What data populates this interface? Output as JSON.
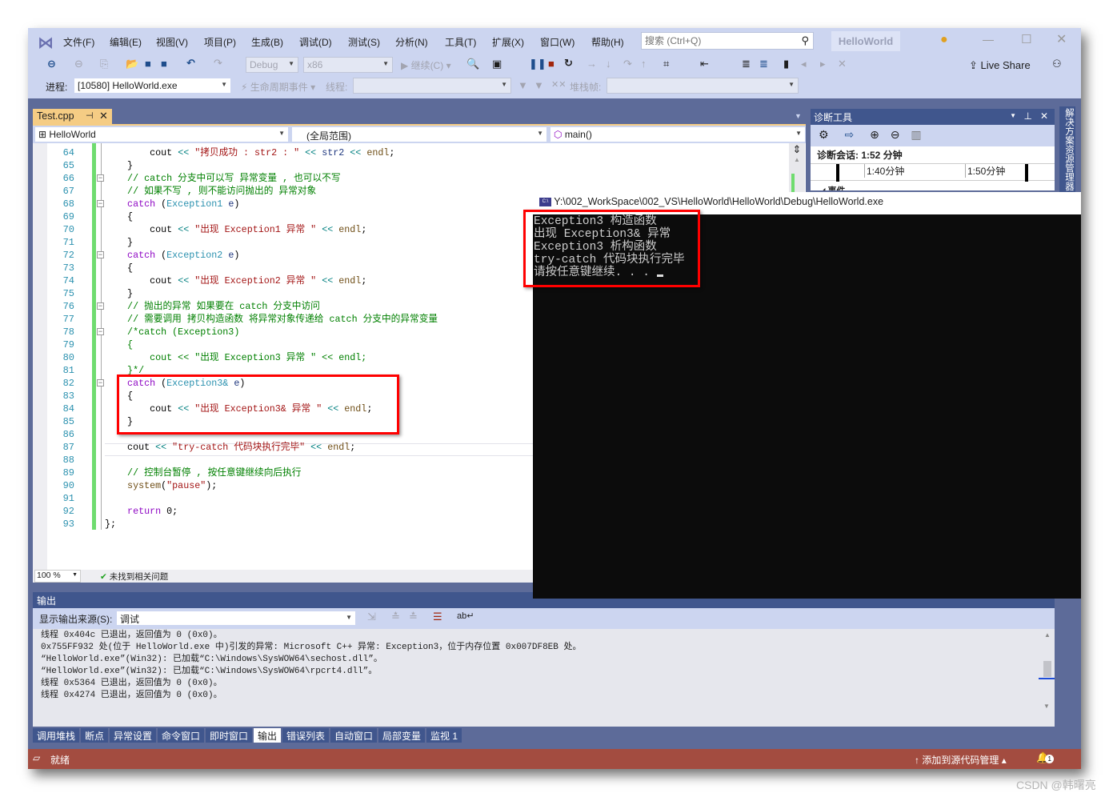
{
  "menu": [
    "文件(F)",
    "编辑(E)",
    "视图(V)",
    "项目(P)",
    "生成(B)",
    "调试(D)",
    "测试(S)",
    "分析(N)",
    "工具(T)",
    "扩展(X)",
    "窗口(W)",
    "帮助(H)"
  ],
  "search": {
    "placeholder": "搜索 (Ctrl+Q)"
  },
  "solution_name": "HelloWorld",
  "toolbar": {
    "config": "Debug",
    "platform": "x86",
    "continue": "继续(C)",
    "live_share": "Live Share"
  },
  "debug_bar": {
    "process_label": "进程:",
    "process_value": "[10580] HelloWorld.exe",
    "lifecycle": "生命周期事件",
    "thread_label": "线程:",
    "stack_label": "堆栈帧:"
  },
  "doc_tab": {
    "name": "Test.cpp"
  },
  "nav": {
    "project": "HelloWorld",
    "scope": "(全局范围)",
    "member": "main()"
  },
  "code_lines": [
    {
      "n": "64",
      "fold": false,
      "tokens": [
        [
          "        cout ",
          "pl"
        ],
        [
          "<< ",
          "op"
        ],
        [
          "\"拷贝成功 : str2 : \" ",
          "st"
        ],
        [
          "<< ",
          "op"
        ],
        [
          "str2 ",
          "vr"
        ],
        [
          "<< ",
          "op"
        ],
        [
          "endl",
          "fn"
        ],
        [
          ";",
          "pl"
        ]
      ]
    },
    {
      "n": "65",
      "fold": false,
      "tokens": [
        [
          "    }",
          "pl"
        ]
      ]
    },
    {
      "n": "66",
      "fold": true,
      "tokens": [
        [
          "    // catch 分支中可以写 异常变量 , 也可以不写",
          "cm"
        ]
      ]
    },
    {
      "n": "67",
      "fold": false,
      "tokens": [
        [
          "    // 如果不写 , 则不能访问抛出的 异常对象",
          "cm"
        ]
      ]
    },
    {
      "n": "68",
      "fold": true,
      "tokens": [
        [
          "    catch ",
          "kw"
        ],
        [
          "(",
          "pl"
        ],
        [
          "Exception1 ",
          "ty"
        ],
        [
          "e",
          "vr"
        ],
        [
          ")",
          "pl"
        ]
      ]
    },
    {
      "n": "69",
      "fold": false,
      "tokens": [
        [
          "    {",
          "pl"
        ]
      ]
    },
    {
      "n": "70",
      "fold": false,
      "tokens": [
        [
          "        cout ",
          "pl"
        ],
        [
          "<< ",
          "op"
        ],
        [
          "\"出现 Exception1 异常 \" ",
          "st"
        ],
        [
          "<< ",
          "op"
        ],
        [
          "endl",
          "fn"
        ],
        [
          ";",
          "pl"
        ]
      ]
    },
    {
      "n": "71",
      "fold": false,
      "tokens": [
        [
          "    }",
          "pl"
        ]
      ]
    },
    {
      "n": "72",
      "fold": true,
      "tokens": [
        [
          "    catch ",
          "kw"
        ],
        [
          "(",
          "pl"
        ],
        [
          "Exception2 ",
          "ty"
        ],
        [
          "e",
          "vr"
        ],
        [
          ")",
          "pl"
        ]
      ]
    },
    {
      "n": "73",
      "fold": false,
      "tokens": [
        [
          "    {",
          "pl"
        ]
      ]
    },
    {
      "n": "74",
      "fold": false,
      "tokens": [
        [
          "        cout ",
          "pl"
        ],
        [
          "<< ",
          "op"
        ],
        [
          "\"出现 Exception2 异常 \" ",
          "st"
        ],
        [
          "<< ",
          "op"
        ],
        [
          "endl",
          "fn"
        ],
        [
          ";",
          "pl"
        ]
      ]
    },
    {
      "n": "75",
      "fold": false,
      "tokens": [
        [
          "    }",
          "pl"
        ]
      ]
    },
    {
      "n": "76",
      "fold": true,
      "tokens": [
        [
          "    // 抛出的异常 如果要在 catch 分支中访问",
          "cm"
        ]
      ]
    },
    {
      "n": "77",
      "fold": false,
      "tokens": [
        [
          "    // 需要调用 拷贝构造函数 将异常对象传递给 catch 分支中的异常变量",
          "cm"
        ]
      ]
    },
    {
      "n": "78",
      "fold": true,
      "tokens": [
        [
          "    /*catch (Exception3)",
          "cm"
        ]
      ]
    },
    {
      "n": "79",
      "fold": false,
      "tokens": [
        [
          "    {",
          "cm"
        ]
      ]
    },
    {
      "n": "80",
      "fold": false,
      "tokens": [
        [
          "        cout << \"出现 Exception3 异常 \" << endl;",
          "cm"
        ]
      ]
    },
    {
      "n": "81",
      "fold": false,
      "tokens": [
        [
          "    }*/",
          "cm"
        ]
      ]
    },
    {
      "n": "82",
      "fold": true,
      "tokens": [
        [
          "    catch ",
          "kw"
        ],
        [
          "(",
          "pl"
        ],
        [
          "Exception3& ",
          "ty"
        ],
        [
          "e",
          "vr"
        ],
        [
          ")",
          "pl"
        ]
      ]
    },
    {
      "n": "83",
      "fold": false,
      "tokens": [
        [
          "    {",
          "pl"
        ]
      ]
    },
    {
      "n": "84",
      "fold": false,
      "tokens": [
        [
          "        cout ",
          "pl"
        ],
        [
          "<< ",
          "op"
        ],
        [
          "\"出现 Exception3& 异常 \" ",
          "st"
        ],
        [
          "<< ",
          "op"
        ],
        [
          "endl",
          "fn"
        ],
        [
          ";",
          "pl"
        ]
      ]
    },
    {
      "n": "85",
      "fold": false,
      "tokens": [
        [
          "    }",
          "pl"
        ]
      ]
    },
    {
      "n": "86",
      "fold": false,
      "tokens": [
        [
          "",
          "pl"
        ]
      ]
    },
    {
      "n": "87",
      "fold": false,
      "tokens": [
        [
          "    cout ",
          "pl"
        ],
        [
          "<< ",
          "op"
        ],
        [
          "\"try-catch 代码块执行完毕\" ",
          "st"
        ],
        [
          "<< ",
          "op"
        ],
        [
          "endl",
          "fn"
        ],
        [
          ";",
          "pl"
        ]
      ]
    },
    {
      "n": "88",
      "fold": false,
      "tokens": [
        [
          "",
          "pl"
        ]
      ]
    },
    {
      "n": "89",
      "fold": false,
      "tokens": [
        [
          "    // 控制台暂停 , 按任意键继续向后执行",
          "cm"
        ]
      ]
    },
    {
      "n": "90",
      "fold": false,
      "tokens": [
        [
          "    system",
          "fn"
        ],
        [
          "(",
          "pl"
        ],
        [
          "\"pause\"",
          "st"
        ],
        [
          ");",
          "pl"
        ]
      ]
    },
    {
      "n": "91",
      "fold": false,
      "tokens": [
        [
          "",
          "pl"
        ]
      ]
    },
    {
      "n": "92",
      "fold": false,
      "tokens": [
        [
          "    return ",
          "kw"
        ],
        [
          "0;",
          "pl"
        ]
      ]
    },
    {
      "n": "93",
      "fold": false,
      "tokens": [
        [
          "};",
          "pl"
        ]
      ]
    }
  ],
  "editor_status": {
    "zoom": "100 %",
    "issues": "未找到相关问题"
  },
  "diagnostics": {
    "title": "诊断工具",
    "session": "诊断会话: 1:52 分钟",
    "tick1": "1:40分钟",
    "tick2": "1:50分钟",
    "events": "事件"
  },
  "side_tab": "解决方案资源管理器",
  "console": {
    "title": "Y:\\002_WorkSpace\\002_VS\\HelloWorld\\HelloWorld\\Debug\\HelloWorld.exe",
    "lines": [
      "Exception3 构造函数",
      "出现 Exception3& 异常",
      "Exception3 析构函数",
      "try-catch 代码块执行完毕",
      "请按任意键继续. . . "
    ]
  },
  "output": {
    "title": "输出",
    "source_label": "显示输出来源(S):",
    "source_value": "调试",
    "lines": [
      "线程 0x404c 已退出，返回值为 0 (0x0)。",
      "0x755FF932 处(位于 HelloWorld.exe 中)引发的异常: Microsoft C++ 异常: Exception3，位于内存位置 0x007DF8EB 处。",
      "“HelloWorld.exe”(Win32): 已加载“C:\\Windows\\SysWOW64\\sechost.dll”。",
      "“HelloWorld.exe”(Win32): 已加载“C:\\Windows\\SysWOW64\\rpcrt4.dll”。",
      "线程 0x5364 已退出，返回值为 0 (0x0)。",
      "线程 0x4274 已退出，返回值为 0 (0x0)。"
    ]
  },
  "bottom_tabs": [
    "调用堆栈",
    "断点",
    "异常设置",
    "命令窗口",
    "即时窗口",
    "输出",
    "错误列表",
    "自动窗口",
    "局部变量",
    "监视 1"
  ],
  "active_bottom_tab": "输出",
  "status": {
    "text": "就绪",
    "source_control": "添加到源代码管理",
    "notifications": "1"
  },
  "watermark": "CSDN @韩曙亮",
  "colors": {
    "chrome": "#ccd5f0",
    "frame": "#5d6b99",
    "status_bar": "#a34c40",
    "active_tab": "#f5cc84",
    "highlight": "#ff0000"
  }
}
